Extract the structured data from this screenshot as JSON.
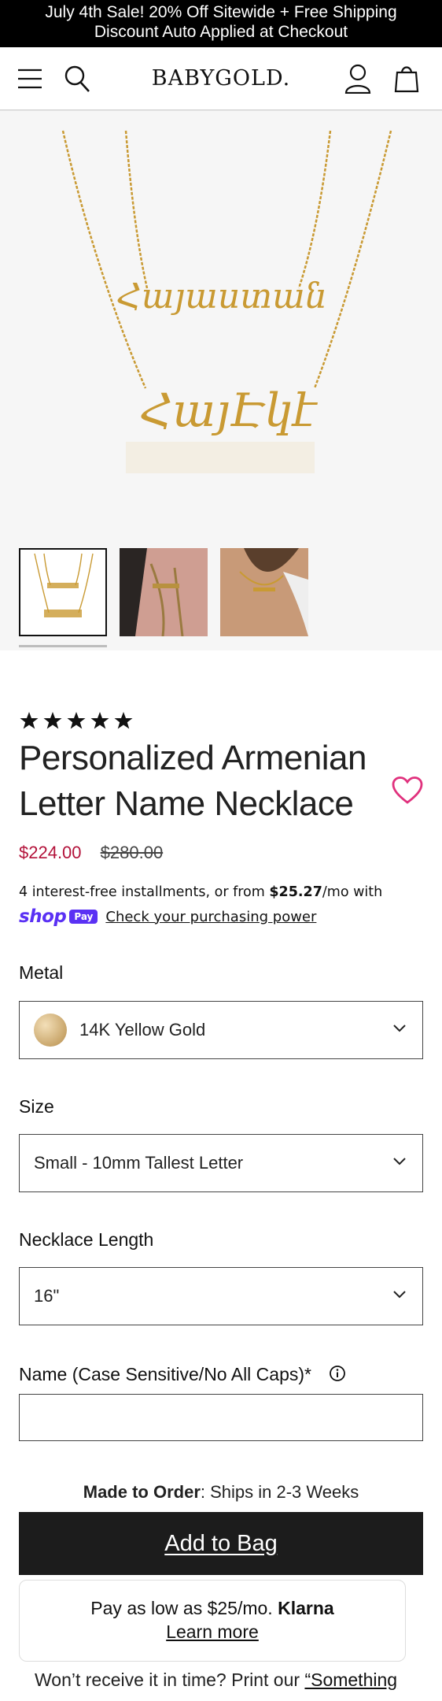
{
  "announcement": {
    "line1": "July 4th Sale! 20% Off Sitewide + Free Shipping",
    "line2": "Discount Auto Applied at Checkout"
  },
  "header": {
    "logo": "BABYGOLD.",
    "icons": [
      "menu-icon",
      "search-icon",
      "account-icon",
      "cart-icon"
    ]
  },
  "product": {
    "pendant_text_top": "Հայաստան",
    "pendant_text_bottom": "ՀայԷկէ",
    "rating_stars": 5,
    "title": "Personalized Armenian Letter Name Necklace",
    "price_sale": "$224.00",
    "price_original": "$280.00",
    "installments_prefix": "4 interest-free installments, or from ",
    "installments_amount": "$25.27",
    "installments_suffix": "/mo with",
    "shop_pay_word": "shop",
    "shop_pay_badge": "Pay",
    "check_power_link": "Check your purchasing power"
  },
  "options": {
    "metal_label": "Metal",
    "metal_value": "14K Yellow Gold",
    "size_label": "Size",
    "size_value": "Small - 10mm Tallest Letter",
    "length_label": "Necklace Length",
    "length_value": "16\"",
    "name_label": "Name (Case Sensitive/No All Caps)*",
    "name_value": ""
  },
  "purchase": {
    "made_to_order_bold": "Made to Order",
    "made_to_order_rest": ": Ships in 2-3 Weeks",
    "add_to_bag": "Add to Bag",
    "klarna_text": "Pay as low as $25/mo.",
    "klarna_brand": "Klarna",
    "klarna_learn": "Learn more",
    "notime_text": "Won’t receive it in time? Print our ",
    "notime_link": "“Something"
  },
  "colors": {
    "announcement_bg": "#000000",
    "sale_price": "#b3123a",
    "heart": "#e0317d",
    "shop_pay": "#5a31f4",
    "add_button_bg": "#1c1c1c",
    "gold": "#c99a33"
  }
}
